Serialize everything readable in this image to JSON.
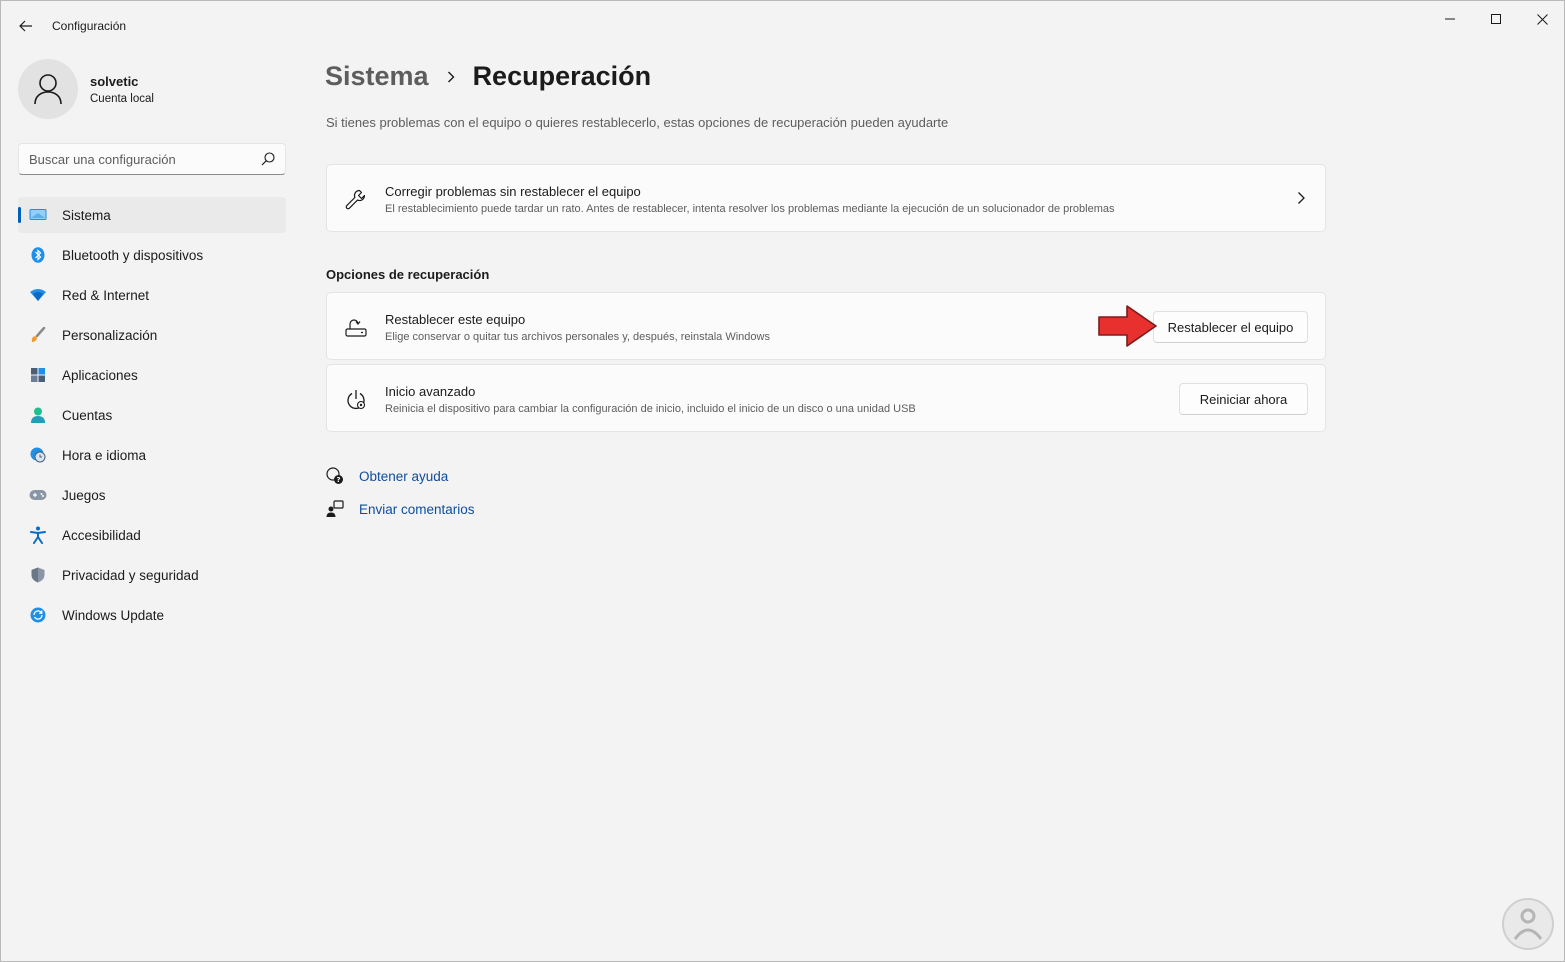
{
  "window": {
    "title": "Configuración"
  },
  "user": {
    "name": "solvetic",
    "account_type": "Cuenta local"
  },
  "search": {
    "placeholder": "Buscar una configuración"
  },
  "nav": [
    {
      "label": "Sistema",
      "icon": "monitor-icon",
      "active": true
    },
    {
      "label": "Bluetooth y dispositivos",
      "icon": "bluetooth-icon"
    },
    {
      "label": "Red & Internet",
      "icon": "wifi-icon"
    },
    {
      "label": "Personalización",
      "icon": "brush-icon"
    },
    {
      "label": "Aplicaciones",
      "icon": "apps-icon"
    },
    {
      "label": "Cuentas",
      "icon": "person-icon"
    },
    {
      "label": "Hora e idioma",
      "icon": "clock-globe-icon"
    },
    {
      "label": "Juegos",
      "icon": "gamepad-icon"
    },
    {
      "label": "Accesibilidad",
      "icon": "accessibility-icon"
    },
    {
      "label": "Privacidad y seguridad",
      "icon": "shield-icon"
    },
    {
      "label": "Windows Update",
      "icon": "update-icon"
    }
  ],
  "main": {
    "breadcrumb_parent": "Sistema",
    "breadcrumb_current": "Recuperación",
    "description": "Si tienes problemas con el equipo o quieres restablecerlo, estas opciones de recuperación pueden ayudarte",
    "troubleshoot": {
      "title": "Corregir problemas sin restablecer el equipo",
      "subtitle": "El restablecimiento puede tardar un rato. Antes de restablecer, intenta resolver los problemas mediante la ejecución de un solucionador de problemas"
    },
    "section_title": "Opciones de recuperación",
    "reset": {
      "title": "Restablecer este equipo",
      "subtitle": "Elige conservar o quitar tus archivos personales y, después, reinstala Windows",
      "button": "Restablecer el equipo"
    },
    "advanced": {
      "title": "Inicio avanzado",
      "subtitle": "Reinicia el dispositivo para cambiar la configuración de inicio, incluido el inicio de un disco o una unidad USB",
      "button": "Reiniciar ahora"
    },
    "links": {
      "help": "Obtener ayuda",
      "feedback": "Enviar comentarios"
    }
  },
  "colors": {
    "accent": "#005fb8",
    "link": "#0f4c9e",
    "arrow": "#e8302f"
  }
}
